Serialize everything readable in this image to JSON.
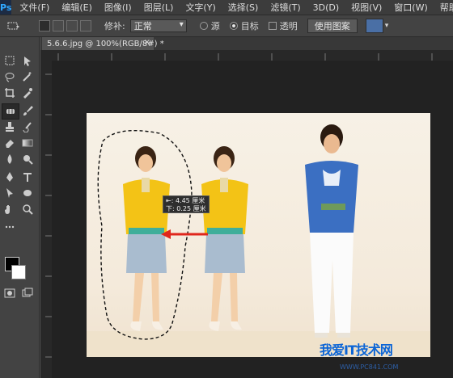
{
  "app": {
    "logo": "Ps"
  },
  "menu": [
    "文件(F)",
    "编辑(E)",
    "图像(I)",
    "图层(L)",
    "文字(Y)",
    "选择(S)",
    "滤镜(T)",
    "3D(D)",
    "视图(V)",
    "窗口(W)",
    "帮助(H)"
  ],
  "options": {
    "patch_label": "修补:",
    "mode_value": "正常",
    "source_label": "源",
    "target_label": "目标",
    "transparent_label": "透明",
    "use_pattern_label": "使用图案",
    "mode": "target"
  },
  "document": {
    "tab_title": "5.6.6.jpg @ 100%(RGB/8#) *",
    "close_glyph": "×"
  },
  "tooltip": {
    "dx_line": "⇤: 4.45 厘米",
    "dy_line": "下: 0.25 厘米"
  },
  "watermark": {
    "text": "我爱IT技术网",
    "url": "WWW.PC841.COM"
  },
  "colors": {
    "foreground": "#000000",
    "background": "#ffffff",
    "accent": "#31a8ff"
  }
}
